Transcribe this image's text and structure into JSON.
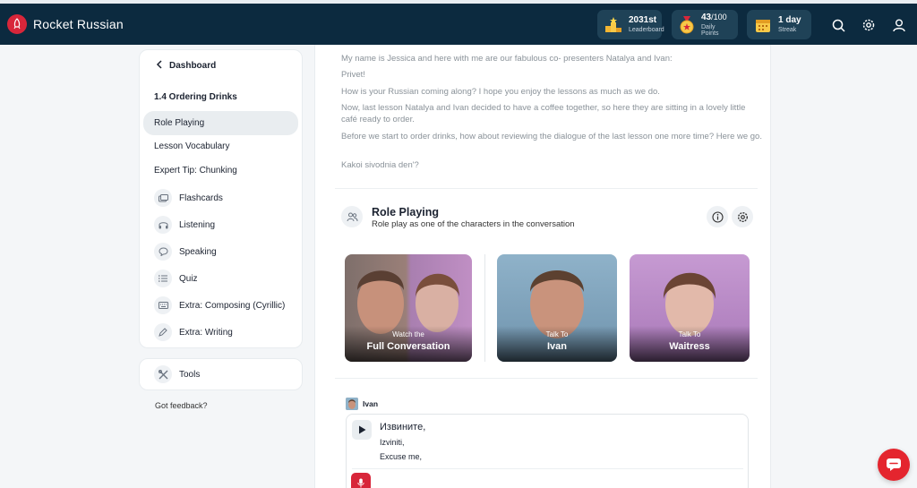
{
  "app": {
    "brand": "Rocket Russian"
  },
  "stats": {
    "leaderboard": {
      "value": "2031st",
      "label": "Leaderboard"
    },
    "points": {
      "value": "43",
      "max": "/100",
      "label": "Daily Points"
    },
    "streak": {
      "value": "1 day",
      "label": "Streak"
    }
  },
  "sidebar": {
    "back_label": "Dashboard",
    "lesson_title": "1.4 Ordering Drinks",
    "items": [
      {
        "label": "Role Playing"
      },
      {
        "label": "Lesson Vocabulary"
      },
      {
        "label": "Expert Tip: Chunking"
      },
      {
        "label": "Flashcards",
        "icon": "flashcards-icon"
      },
      {
        "label": "Listening",
        "icon": "headphones-icon"
      },
      {
        "label": "Speaking",
        "icon": "speech-bubble-icon"
      },
      {
        "label": "Quiz",
        "icon": "list-icon"
      },
      {
        "label": "Extra: Composing (Cyrillic)",
        "icon": "keyboard-icon"
      },
      {
        "label": "Extra: Writing",
        "icon": "pencil-icon"
      }
    ],
    "tools_label": "Tools",
    "feedback_label": "Got feedback?"
  },
  "transcript": [
    "My name is Jessica and here with me are our fabulous co- presenters Natalya and Ivan:",
    "Privet!",
    "How is your Russian coming along? I hope you enjoy the lessons as much as we do.",
    "Now, last lesson Natalya and Ivan decided to have a coffee together, so here they are sitting in a lovely little café ready to order.",
    "Before we start to order drinks, how about reviewing the dialogue of the last lesson one more time? Here we go.",
    "Kakoi sivodnia den'?"
  ],
  "role_playing": {
    "title": "Role Playing",
    "subtitle": "Role play as one of the characters in the conversation",
    "cards": [
      {
        "small": "Watch the",
        "big": "Full Conversation"
      },
      {
        "small": "Talk To",
        "big": "Ivan"
      },
      {
        "small": "Talk To",
        "big": "Waitress"
      }
    ]
  },
  "dialogue": {
    "speaker": "Ivan",
    "cyrillic": "Извините,",
    "latin": "Izviniti,",
    "english": "Excuse me,"
  },
  "colors": {
    "topbar": "#0c2a3f",
    "accent": "#d8263a"
  }
}
